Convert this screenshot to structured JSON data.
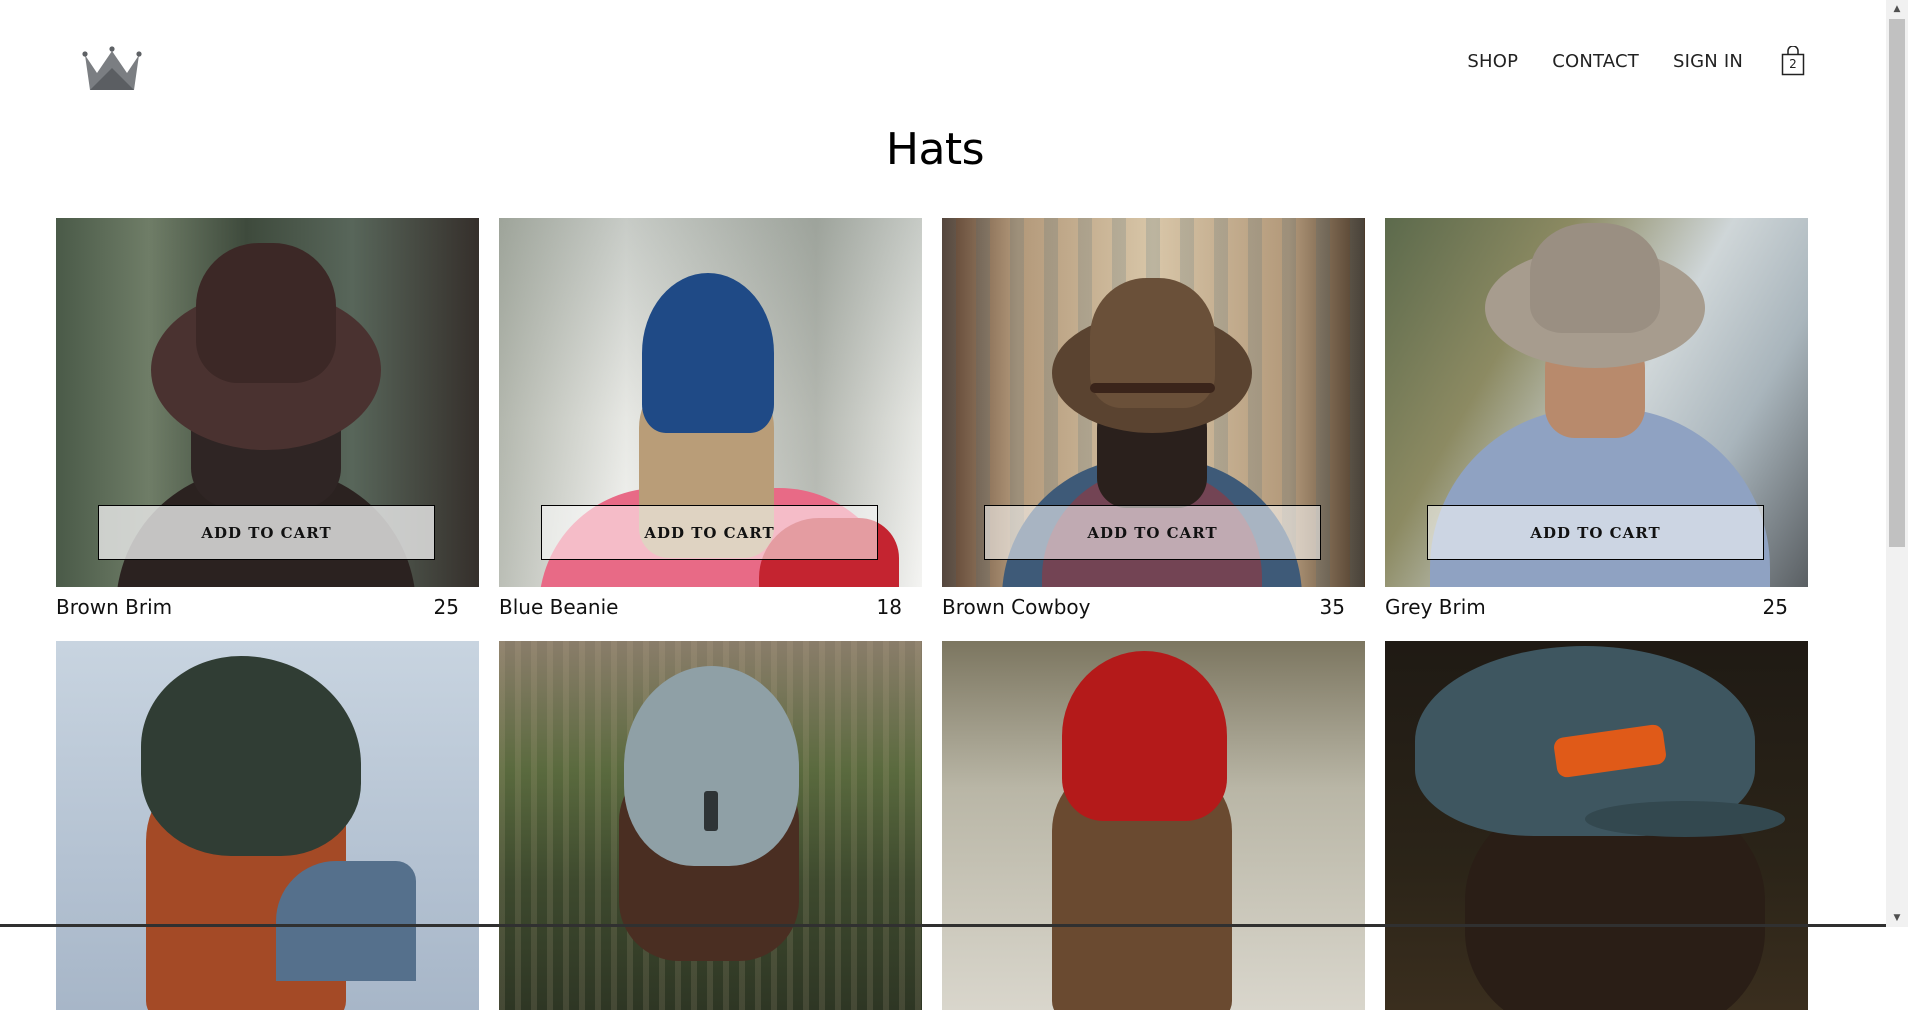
{
  "header": {
    "logo_icon": "crown-icon",
    "nav": {
      "shop": "SHOP",
      "contact": "CONTACT",
      "sign_in": "SIGN IN"
    },
    "cart": {
      "icon": "shopping-bag-icon",
      "count": "2"
    }
  },
  "page": {
    "title": "Hats"
  },
  "products": [
    {
      "name": "Brown Brim",
      "price": "25",
      "button": "ADD TO CART"
    },
    {
      "name": "Blue Beanie",
      "price": "18",
      "button": "ADD TO CART"
    },
    {
      "name": "Brown Cowboy",
      "price": "35",
      "button": "ADD TO CART"
    },
    {
      "name": "Grey Brim",
      "price": "25",
      "button": "ADD TO CART"
    },
    {
      "name": "",
      "price": ""
    },
    {
      "name": "",
      "price": ""
    },
    {
      "name": "",
      "price": ""
    },
    {
      "name": "",
      "price": ""
    }
  ],
  "colors": {
    "nav_text": "#222222",
    "button_border": "#000000",
    "scrollbar_track": "#f1f1f1",
    "scrollbar_thumb": "#c1c1c1"
  }
}
